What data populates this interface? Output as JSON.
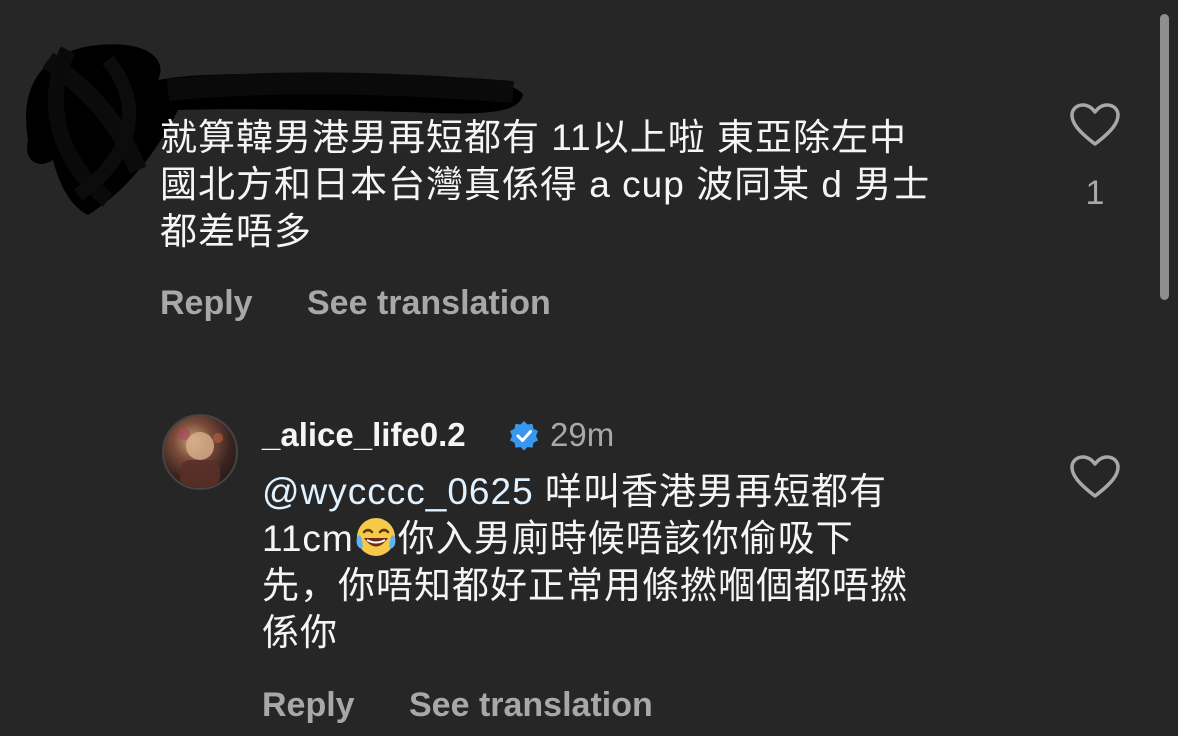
{
  "comment1": {
    "text": "就算韓男港男再短都有 11以上啦 東亞除左中\n國北方和日本台灣真係得 a cup 波同某 d 男士\n都差唔多",
    "like_count": "1",
    "reply_label": "Reply",
    "translate_label": "See translation"
  },
  "comment2": {
    "username": "_alice_life0.2",
    "time": "29m",
    "mention": "@wycccc_0625",
    "text_a": " 咩叫香港男再短都有\n11cm",
    "text_b": "你入男廁時候唔該你偷吸下\n先，你唔知都好正常用條撚嗰個都唔撚\n係你",
    "reply_label": "Reply",
    "translate_label": "See translation"
  },
  "colors": {
    "background": "#262626",
    "primary_text": "#f5f5f5",
    "secondary_text": "#a8a8a8",
    "mention": "#e0f1ff",
    "verified": "#3897f0"
  },
  "icons": [
    "heart-icon",
    "verified-badge-icon",
    "laughing-tears-emoji"
  ]
}
